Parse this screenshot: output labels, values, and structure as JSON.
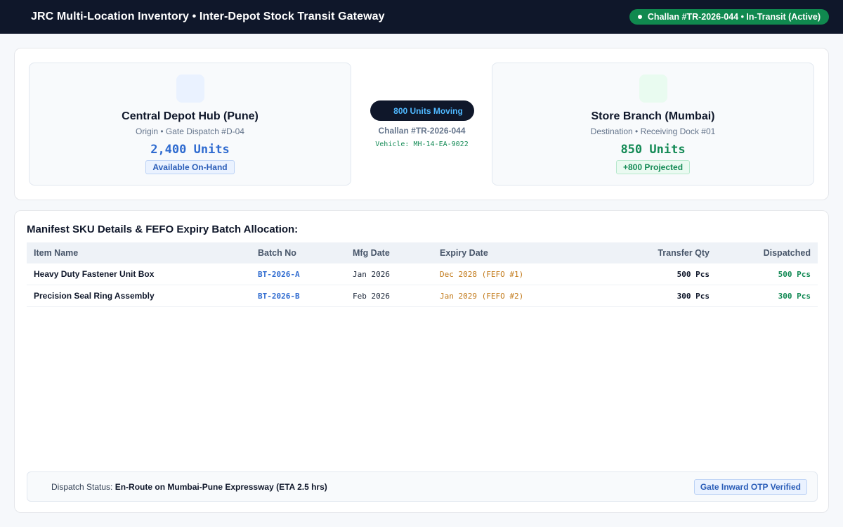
{
  "header": {
    "title": "JRC Multi-Location Inventory • Inter-Depot Stock Transit Gateway",
    "status_pill": "Challan #TR-2026-044 • In-Transit (Active)"
  },
  "route": {
    "origin": {
      "name": "Central Depot Hub (Pune)",
      "subtitle": "Origin • Gate Dispatch #D-04",
      "units": "2,400 Units",
      "badge": "Available On-Hand",
      "icon": "warehouse-icon"
    },
    "transit": {
      "moving": "800 Units Moving",
      "challan": "Challan #TR-2026-044",
      "vehicle": "Vehicle: MH-14-EA-9022"
    },
    "destination": {
      "name": "Store Branch (Mumbai)",
      "subtitle": "Destination • Receiving Dock #01",
      "units": "850 Units",
      "badge": "+800 Projected",
      "icon": "store-icon"
    }
  },
  "manifest": {
    "title": "Manifest SKU Details & FEFO Expiry Batch Allocation:",
    "columns": [
      "Item Name",
      "Batch No",
      "Mfg Date",
      "Expiry Date",
      "Transfer Qty",
      "Dispatched"
    ],
    "rows": [
      {
        "item": "Heavy Duty Fastener Unit Box",
        "batch": "BT-2026-A",
        "mfg": "Jan 2026",
        "expiry": "Dec 2028 (FEFO #1)",
        "qty": "500 Pcs",
        "dispatched": "500 Pcs"
      },
      {
        "item": "Precision Seal Ring Assembly",
        "batch": "BT-2026-B",
        "mfg": "Feb 2026",
        "expiry": "Jan 2029 (FEFO #2)",
        "qty": "300 Pcs",
        "dispatched": "300 Pcs"
      }
    ]
  },
  "footer": {
    "dispatch_label": "Dispatch Status:",
    "dispatch_value": "En-Route on Mumbai-Pune Expressway (ETA 2.5 hrs)",
    "otp_badge": "Gate Inward OTP Verified"
  },
  "colors": {
    "topbar": "#0f172a",
    "status_green": "#10894f",
    "origin_blue": "#2f6bd0",
    "dest_green": "#138a55",
    "expiry_amber": "#c27a1a"
  }
}
